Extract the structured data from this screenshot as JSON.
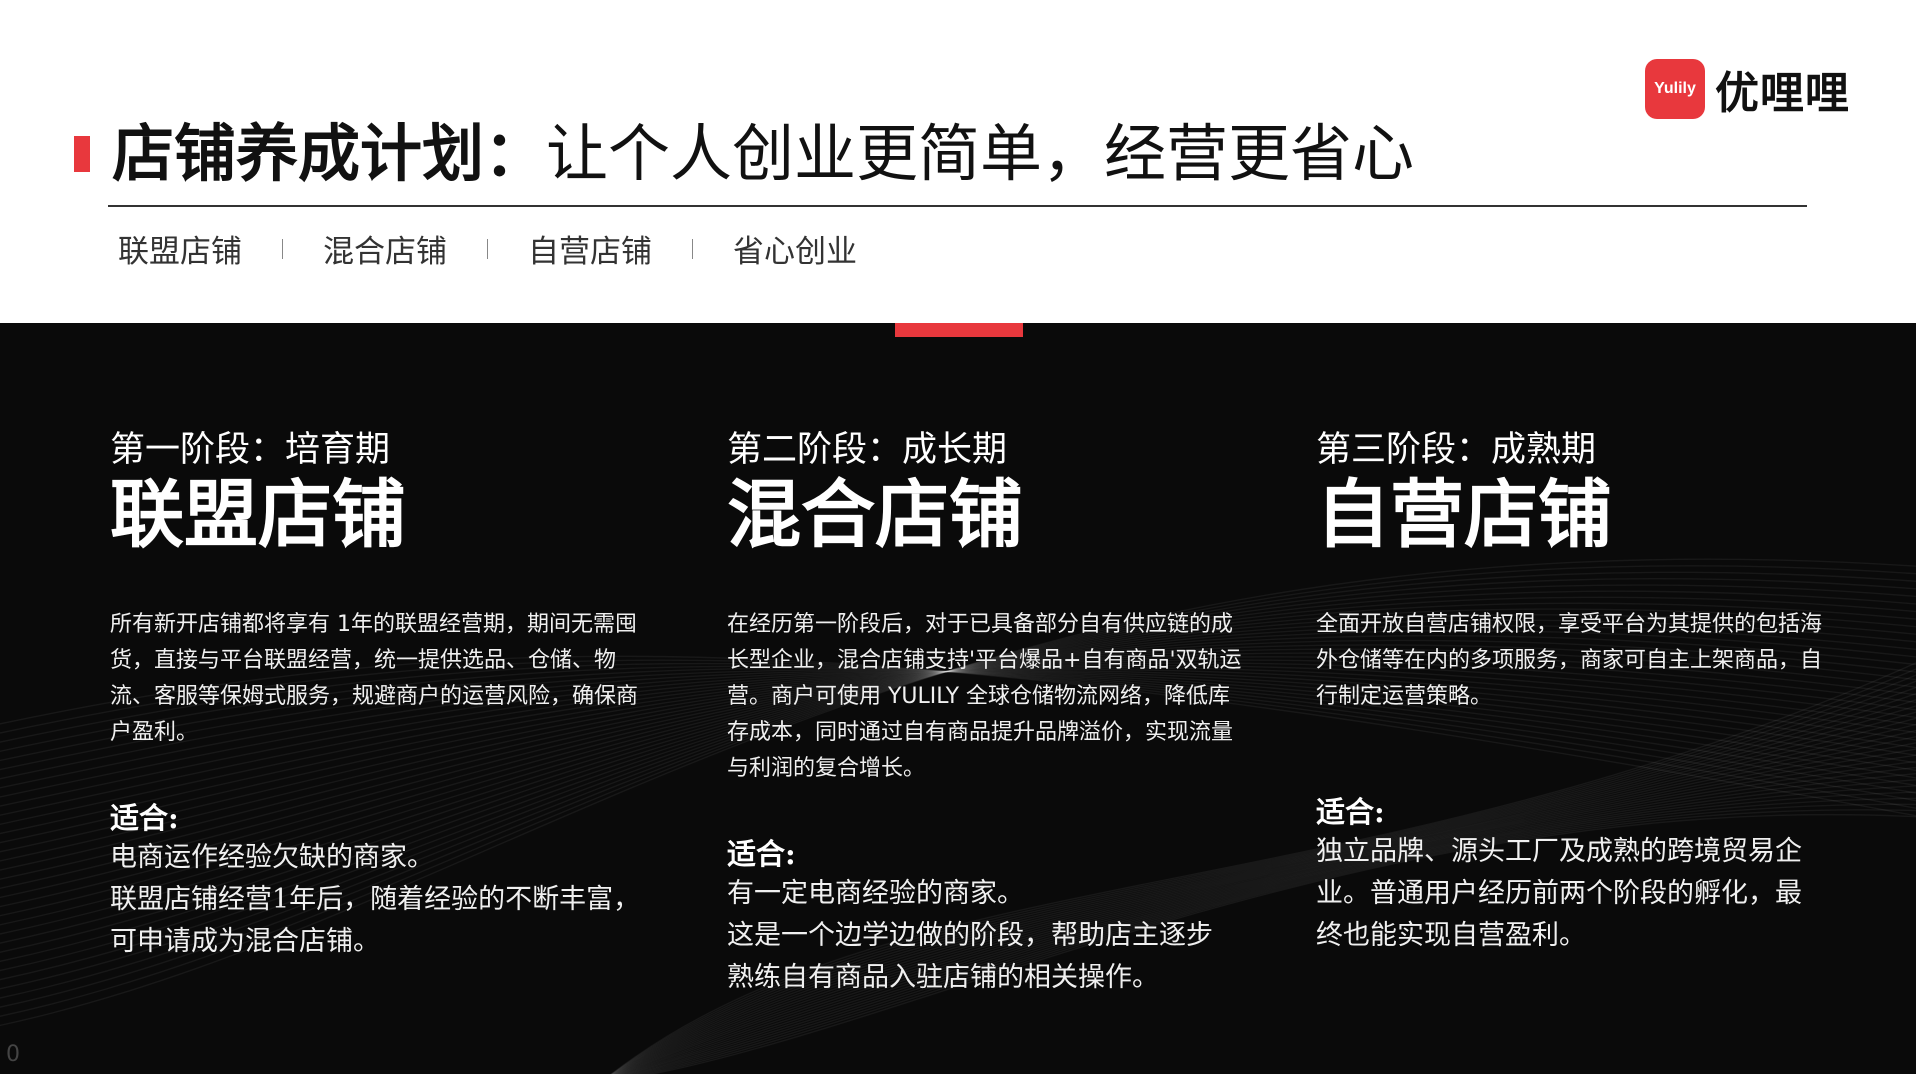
{
  "logo": {
    "mark": "Yulily",
    "text": "优哩哩",
    "color": "#e8383d"
  },
  "header": {
    "title_main": "店铺养成计划：",
    "title_rest": "让个人创业更简单，经营更省心",
    "accent_color": "#e8383d"
  },
  "tabs": [
    "联盟店铺",
    "混合店铺",
    "自营店铺",
    "省心创业"
  ],
  "stages": [
    {
      "label": "第一阶段：培育期",
      "name": "联盟店铺",
      "desc": "所有新开店铺都将享有 1年的联盟经营期，期间无需囤货，直接与平台联盟经营，统一提供选品、仓储、物流、客服等保姆式服务，规避商户的运营风险，确保商户盈利。",
      "fit_title": "适合:",
      "fit_lines": [
        "电商运作经验欠缺的商家。",
        "联盟店铺经营1年后，随着经验的不断丰富，",
        "可申请成为混合店铺。"
      ]
    },
    {
      "label": "第二阶段：成长期",
      "name": "混合店铺",
      "desc": "在经历第一阶段后，对于已具备部分自有供应链的成长型企业，混合店铺支持'平台爆品+自有商品'双轨运营。商户可使用 YULILY 全球仓储物流网络，降低库存成本，同时通过自有商品提升品牌溢价，实现流量与利润的复合增长。",
      "fit_title": "适合:",
      "fit_lines": [
        "有一定电商经验的商家。",
        "这是一个边学边做的阶段，帮助店主逐步",
        "熟练自有商品入驻店铺的相关操作。"
      ]
    },
    {
      "label": "第三阶段：成熟期",
      "name": "自营店铺",
      "desc": "全面开放自营店铺权限，享受平台为其提供的包括海外仓储等在内的多项服务，商家可自主上架商品，自行制定运营策略。",
      "fit_title": "适合:",
      "fit_lines": [
        "独立品牌、源头工厂及成熟的跨境贸易企",
        "业。普通用户经历前两个阶段的孵化，最",
        "终也能实现自营盈利。"
      ]
    }
  ],
  "footer": {
    "corner_mark": "0"
  }
}
